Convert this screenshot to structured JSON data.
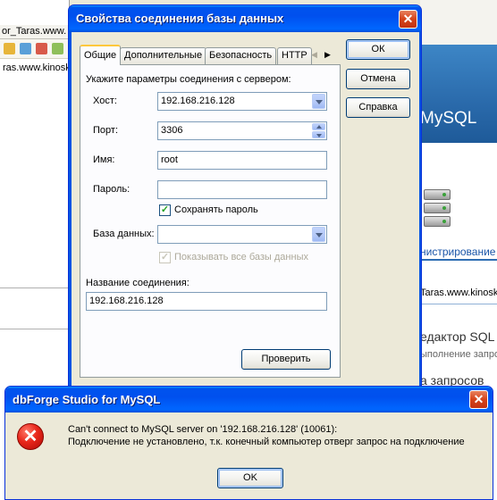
{
  "background": {
    "doc_tab": "or_Taras.www.",
    "tree_item": "ras.www.kinoskor",
    "right_banner_text": "MySQL",
    "right_admin_link": "нистрирование",
    "right_connection": "Taras.www.kinosk",
    "right_editor": "едактор SQL",
    "right_exec": "ыполнение запрос",
    "right_query": "а запросов"
  },
  "conn_dialog": {
    "title": "Свойства соединения базы данных",
    "close_glyph": "✕",
    "tabs": [
      {
        "label": "Общие"
      },
      {
        "label": "Дополнительные"
      },
      {
        "label": "Безопасность"
      },
      {
        "label": "HTTP"
      }
    ],
    "tab_scroll_left": "◀",
    "tab_scroll_right": "▶",
    "section_label": "Укажите параметры соединения с сервером:",
    "host": {
      "label": "Хост:",
      "value": "192.168.216.128"
    },
    "port": {
      "label": "Порт:",
      "value": "3306"
    },
    "user": {
      "label": "Имя:",
      "value": "root"
    },
    "password": {
      "label": "Пароль:",
      "value": ""
    },
    "save_password": {
      "label": "Сохранять пароль",
      "checked": true
    },
    "database": {
      "label": "База данных:",
      "value": ""
    },
    "show_all_db": {
      "label": "Показывать все базы данных",
      "checked": true,
      "enabled": false
    },
    "conn_name": {
      "label": "Название соединения:",
      "value": "192.168.216.128"
    },
    "buttons": {
      "ok": "ОК",
      "cancel": "Отмена",
      "help": "Справка",
      "test": "Проверить"
    }
  },
  "error_dialog": {
    "title": "dbForge Studio for MySQL",
    "close_glyph": "✕",
    "icon_glyph": "✕",
    "message_line1": "Can't connect to MySQL server on '192.168.216.128' (10061):",
    "message_line2": "Подключение не установлено, т.к. конечный компьютер отверг запрос на подключение",
    "ok_button": "OK"
  },
  "colors": {
    "xp_title_blue": "#0054e3",
    "dialog_face": "#ece9d8",
    "checkbox_green": "#21a121",
    "error_red": "#e8261a"
  }
}
